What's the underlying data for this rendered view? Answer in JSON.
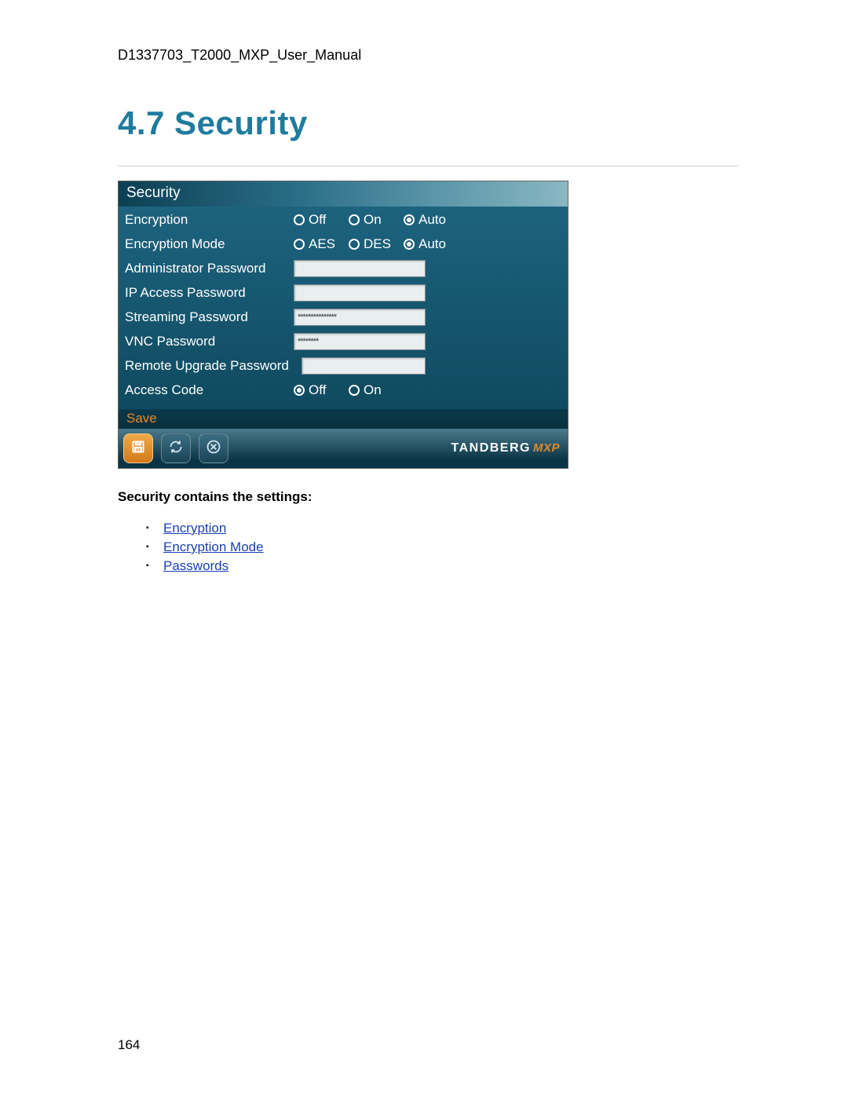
{
  "doc_header": "D1337703_T2000_MXP_User_Manual",
  "heading": "4.7 Security",
  "panel": {
    "title": "Security",
    "rows": {
      "encryption": {
        "label": "Encryption",
        "opts": [
          "Off",
          "On",
          "Auto"
        ],
        "selected": "Auto"
      },
      "encryption_mode": {
        "label": "Encryption Mode",
        "opts": [
          "AES",
          "DES",
          "Auto"
        ],
        "selected": "Auto"
      },
      "admin_pw": {
        "label": "Administrator Password",
        "value": ""
      },
      "ip_pw": {
        "label": "IP Access Password",
        "value": ""
      },
      "streaming_pw": {
        "label": "Streaming Password",
        "value": "***************"
      },
      "vnc_pw": {
        "label": "VNC Password",
        "value": "********"
      },
      "remote_pw": {
        "label": "Remote Upgrade Password",
        "value": ""
      },
      "access_code": {
        "label": "Access Code",
        "opts": [
          "Off",
          "On"
        ],
        "selected": "Off"
      }
    },
    "save_label": "Save",
    "brand_main": "TANDBERG",
    "brand_sub": "MXP"
  },
  "intro_bold": "Security contains the settings:",
  "links": [
    "Encryption",
    "Encryption Mode",
    "Passwords"
  ],
  "page_number": "164"
}
